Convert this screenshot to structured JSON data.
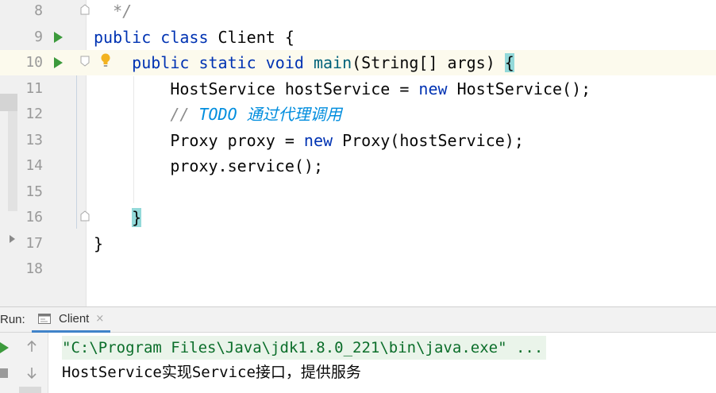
{
  "editor": {
    "lines": [
      {
        "num": "8",
        "tokens": [
          {
            "t": "  */",
            "c": "cm"
          }
        ]
      },
      {
        "num": "9",
        "run": true,
        "tokens": [
          {
            "t": "public ",
            "c": "kw"
          },
          {
            "t": "class ",
            "c": "kw"
          },
          {
            "t": "Client {",
            "c": ""
          }
        ]
      },
      {
        "num": "10",
        "run": true,
        "current": true,
        "tokens": [
          {
            "t": "    public ",
            "c": "kw"
          },
          {
            "t": "static ",
            "c": "kw"
          },
          {
            "t": "void ",
            "c": "kw"
          },
          {
            "t": "main",
            "c": "fn"
          },
          {
            "t": "(String[] args) ",
            "c": ""
          },
          {
            "t": "{",
            "c": "brace"
          }
        ]
      },
      {
        "num": "11",
        "tokens": [
          {
            "t": "        HostService hostService = ",
            "c": ""
          },
          {
            "t": "new ",
            "c": "kw"
          },
          {
            "t": "HostService();",
            "c": ""
          }
        ]
      },
      {
        "num": "12",
        "tokens": [
          {
            "t": "        // ",
            "c": "cm"
          },
          {
            "t": "TODO 通过代理调用",
            "c": "todo"
          }
        ]
      },
      {
        "num": "13",
        "tokens": [
          {
            "t": "        Proxy proxy = ",
            "c": ""
          },
          {
            "t": "new ",
            "c": "kw"
          },
          {
            "t": "Proxy(hostService);",
            "c": ""
          }
        ]
      },
      {
        "num": "14",
        "tokens": [
          {
            "t": "        proxy.service();",
            "c": ""
          }
        ]
      },
      {
        "num": "15",
        "tokens": []
      },
      {
        "num": "16",
        "tokens": [
          {
            "t": "    ",
            "c": ""
          },
          {
            "t": "}",
            "c": "brace"
          }
        ]
      },
      {
        "num": "17",
        "tokens": [
          {
            "t": "}",
            "c": ""
          }
        ]
      },
      {
        "num": "18",
        "tokens": []
      }
    ]
  },
  "run_panel": {
    "label": "Run:",
    "tab_label": "Client",
    "close_glyph": "×",
    "output": {
      "command": "\"C:\\Program Files\\Java\\jdk1.8.0_221\\bin\\java.exe\" ...",
      "text": "HostService实现Service接口，提供服务"
    }
  },
  "colors": {
    "keyword": "#0033b3",
    "method": "#00627a",
    "comment": "#8c8c8c",
    "todo": "#008dde",
    "brace_highlight": "#93d9d9",
    "run_green": "#3c9a3c",
    "output_command": "#0b6e2a"
  },
  "icons": {
    "run_gutter": "play-icon",
    "fold": "fold-icon",
    "intention": "lightbulb-icon",
    "tab": "console-icon",
    "close": "close-icon",
    "rerun": "play-icon",
    "stop": "stop-icon",
    "up": "arrow-up-icon",
    "down": "arrow-down-icon"
  }
}
